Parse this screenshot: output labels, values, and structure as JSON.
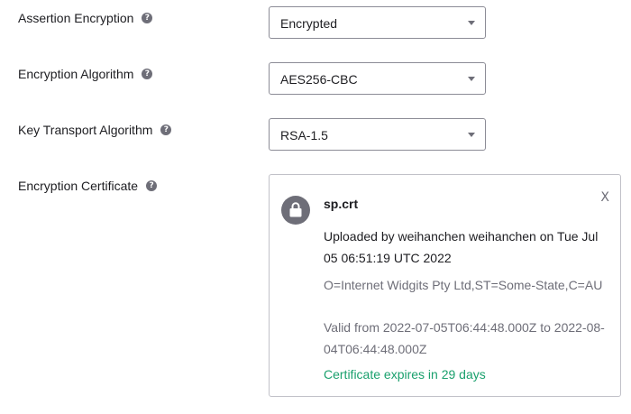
{
  "fields": [
    {
      "label": "Assertion Encryption",
      "value": "Encrypted"
    },
    {
      "label": "Encryption Algorithm",
      "value": "AES256-CBC"
    },
    {
      "label": "Key Transport Algorithm",
      "value": "RSA-1.5"
    }
  ],
  "certificate": {
    "label": "Encryption Certificate",
    "file_name": "sp.crt",
    "uploaded_text": "Uploaded by weihanchen weihanchen on Tue Jul 05 06:51:19 UTC 2022",
    "subject": "O=Internet Widgits Pty Ltd,ST=Some-State,C=AU",
    "validity": "Valid from 2022-07-05T06:44:48.000Z to 2022-08-04T06:44:48.000Z",
    "expiry_status": "Certificate expires in 29 days",
    "close_label": "X"
  },
  "help_glyph": "?",
  "icons": {
    "help": "question-circle-icon",
    "dropdown": "chevron-down-icon",
    "certificate": "lock-icon"
  },
  "colors": {
    "expiry_status": "#1aa06d",
    "icon_gray": "#6e6e78",
    "text": "#1d1d21"
  }
}
